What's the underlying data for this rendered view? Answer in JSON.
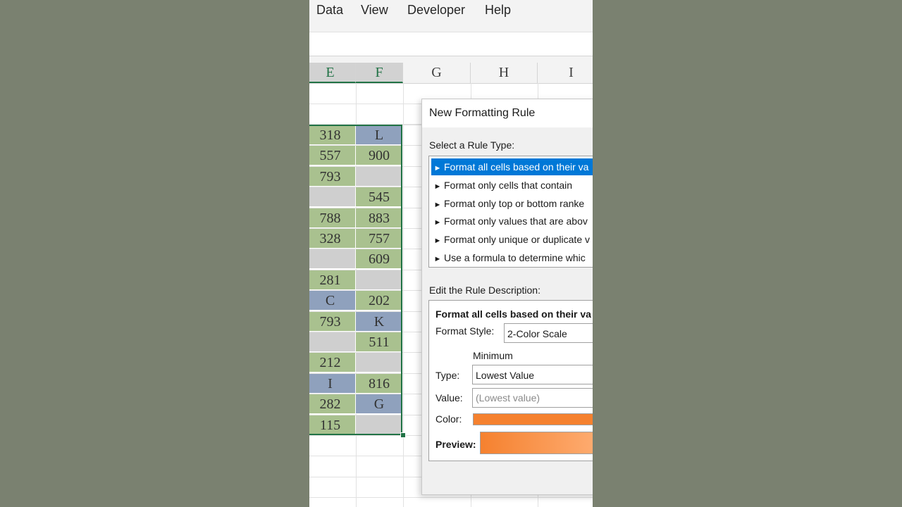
{
  "menu": {
    "items": [
      "Data",
      "View",
      "Developer",
      "Help"
    ]
  },
  "columns": [
    "E",
    "F",
    "G",
    "H",
    "I"
  ],
  "colors": {
    "green_cell": "#a9c18f",
    "blue_cell": "#8fa1bd",
    "gray_cell": "#cfcfcf",
    "accent_green": "#217346",
    "selected_blue": "#0078d7",
    "orange": "#f5812f"
  },
  "cells": [
    {
      "e": "318",
      "e_color": "green",
      "f": "L",
      "f_color": "blue"
    },
    {
      "e": "557",
      "e_color": "green",
      "f": "900",
      "f_color": "green"
    },
    {
      "e": "793",
      "e_color": "green",
      "f": "",
      "f_color": "gray"
    },
    {
      "e": "",
      "e_color": "gray",
      "f": "545",
      "f_color": "green"
    },
    {
      "e": "788",
      "e_color": "green",
      "f": "883",
      "f_color": "green"
    },
    {
      "e": "328",
      "e_color": "green",
      "f": "757",
      "f_color": "green"
    },
    {
      "e": "",
      "e_color": "gray",
      "f": "609",
      "f_color": "green"
    },
    {
      "e": "281",
      "e_color": "green",
      "f": "",
      "f_color": "gray"
    },
    {
      "e": "C",
      "e_color": "blue",
      "f": "202",
      "f_color": "green"
    },
    {
      "e": "793",
      "e_color": "green",
      "f": "K",
      "f_color": "blue"
    },
    {
      "e": "",
      "e_color": "gray",
      "f": "511",
      "f_color": "green"
    },
    {
      "e": "212",
      "e_color": "green",
      "f": "",
      "f_color": "gray"
    },
    {
      "e": "I",
      "e_color": "blue",
      "f": "816",
      "f_color": "green"
    },
    {
      "e": "282",
      "e_color": "green",
      "f": "G",
      "f_color": "blue"
    },
    {
      "e": "115",
      "e_color": "green",
      "f": "",
      "f_color": "gray"
    }
  ],
  "dialog": {
    "title": "New Formatting Rule",
    "select_rule_type_label": "Select a Rule Type:",
    "rule_types": [
      "Format all cells based on their va",
      "Format only cells that contain",
      "Format only top or bottom ranke",
      "Format only values that are abov",
      "Format only unique or duplicate v",
      "Use a formula to determine whic"
    ],
    "selected_rule_index": 0,
    "edit_description_label": "Edit the Rule Description:",
    "description_heading": "Format all cells based on their va",
    "format_style_label": "Format Style:",
    "format_style_value": "2-Color Scale",
    "minimum_label": "Minimum",
    "type_label": "Type:",
    "type_value": "Lowest Value",
    "value_label": "Value:",
    "value_placeholder": "(Lowest value)",
    "color_label": "Color:",
    "preview_label": "Preview:"
  }
}
